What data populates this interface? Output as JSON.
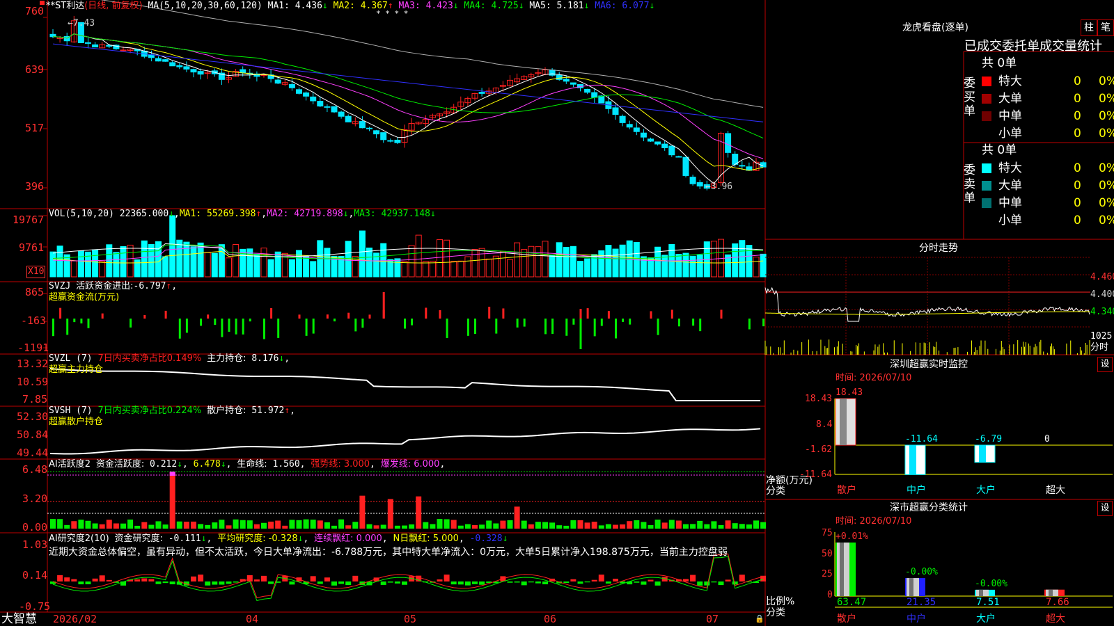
{
  "app_title": "大智慧",
  "colors": {
    "up": "#ff2020",
    "down": "#00e5ff",
    "vol_down": "#00ffff",
    "green": "#00ee00",
    "yellow": "#ffff00",
    "magenta": "#ff40ff",
    "blue": "#3030ff",
    "gray": "#b0b0b0",
    "border": "#c00000",
    "white": "#ffffff"
  },
  "main": {
    "stock": "**ST利达",
    "period": "(日线, 前复权)",
    "ma_legend": [
      {
        "name": "MA(5,10,20,30,60,120)",
        "value": "",
        "arrow": "",
        "color": "#ffffff"
      },
      {
        "name": "MA1:",
        "value": "4.436",
        "arrow": "↓",
        "color": "#ffffff"
      },
      {
        "name": "MA2:",
        "value": "4.367",
        "arrow": "↑",
        "color": "#ffff00"
      },
      {
        "name": "MA3:",
        "value": "4.423",
        "arrow": "↓",
        "color": "#ff40ff"
      },
      {
        "name": "MA4:",
        "value": "4.725",
        "arrow": "↓",
        "color": "#00ee00"
      },
      {
        "name": "MA5:",
        "value": "5.181",
        "arrow": "↓",
        "color": "#ffffff"
      },
      {
        "name": "MA6:",
        "value": "6.077",
        "arrow": "↓",
        "color": "#3030ff"
      }
    ],
    "y_ticks": [
      "760",
      "639",
      "517",
      "396"
    ],
    "high_label": "7.43",
    "low_label": "3.96",
    "stars": "* * *   *"
  },
  "volume": {
    "legend": "VOL(5,10,20)",
    "value": "22365.000",
    "ma1": "55269.398",
    "ma2": "42719.898",
    "ma3": "42937.148",
    "y_ticks": [
      "19767",
      "9761"
    ],
    "unit": "X10"
  },
  "svzj": {
    "legend": "SVZJ",
    "label": "活跃资金进出:",
    "value": "-6.797",
    "sub": "超赢资金流(万元)",
    "y_ticks": [
      "865",
      "-163",
      "-1191"
    ]
  },
  "svzl": {
    "legend": "SVZL (7)",
    "ratio_label": "7日内买卖净占比0.149%",
    "hold_label": "主力持仓:",
    "hold_value": "8.176",
    "sub": "超赢主力持仓",
    "y_ticks": [
      "13.32",
      "10.59",
      "7.85"
    ]
  },
  "svsh": {
    "legend": "SVSH (7)",
    "ratio_label": "7日内买卖净占比0.224%",
    "hold_label": "散户持仓:",
    "hold_value": "51.972",
    "sub": "超赢散户持仓",
    "y_ticks": [
      "52.30",
      "50.84",
      "49.44"
    ]
  },
  "ai_active": {
    "legend": "AI活跃度2",
    "fund_label": "资金活跃度:",
    "fund_value": "0.212",
    "v2": "6.478",
    "life_label": "生命线:",
    "life_value": "1.560",
    "strong": "强势线: 3.000",
    "burst": "爆发线: 6.000",
    "y_ticks": [
      "6.48",
      "3.20",
      "0.00"
    ]
  },
  "ai_research": {
    "legend": "AI研究度2(10)",
    "fund_label": "资金研究度:",
    "fund_value": "-0.111",
    "avg": "平均研究度: -0.328",
    "red": "连续飘红: 0.000",
    "n_red": "N日飘红: 5.000",
    "last": "-0.328",
    "comment": "近期大资金总体偏空，虽有异动，但不太活跃，今日大单净流出：-6.788万元，其中特大单净流入：0万元，大单5日累计净入198.875万元，当前主力控盘弱",
    "y_ticks": [
      "1.03",
      "0.14",
      "-0.75"
    ]
  },
  "x_axis": [
    "2026/02",
    "04",
    "05",
    "06",
    "07"
  ],
  "right": {
    "lhb_title": "龙虎看盘(逐单)",
    "btn_col": "柱",
    "btn_line": "笔",
    "tabs": "已成交委托单成交量统计",
    "buy_label": "委买单",
    "sell_label": "委卖单",
    "buy_total": "共 0单",
    "sell_total": "共 0单",
    "buy_rows": [
      {
        "name": "特大",
        "count": "0",
        "pct": "0%",
        "color": "#ff0000"
      },
      {
        "name": "大单",
        "count": "0",
        "pct": "0%",
        "color": "#a00000"
      },
      {
        "name": "中单",
        "count": "0",
        "pct": "0%",
        "color": "#700000"
      },
      {
        "name": "小单",
        "count": "0",
        "pct": "0%",
        "color": ""
      }
    ],
    "sell_rows": [
      {
        "name": "特大",
        "count": "0",
        "pct": "0%",
        "color": "#00ffff"
      },
      {
        "name": "大单",
        "count": "0",
        "pct": "0%",
        "color": "#009090"
      },
      {
        "name": "中单",
        "count": "0",
        "pct": "0%",
        "color": "#007070"
      },
      {
        "name": "小单",
        "count": "0",
        "pct": "0%",
        "color": ""
      }
    ],
    "intraday_title": "分时走势",
    "intraday_ticks": [
      "4.460",
      "4.400",
      "4.340"
    ],
    "intraday_vol": "1025",
    "intraday_unit": "分时",
    "sz_title": "深圳超赢实时监控",
    "settings": "设",
    "sz_time": "时间: 2026/07/10",
    "sz_ticks": [
      "18.43",
      "8.4",
      "-1.62",
      "-11.64"
    ],
    "sz_ylabel": "净额(万元)",
    "sz_xlabel": "分类",
    "sz_cats": [
      "散户",
      "中户",
      "大户",
      "超大"
    ],
    "sz_values": [
      18.43,
      -11.64,
      -6.79,
      0
    ],
    "sz_labels": [
      "18.43",
      "-11.64",
      "-6.79",
      "0"
    ],
    "cls_title": "深市超赢分类统计",
    "cls_time": "时间: 2026/07/10",
    "cls_ticks": [
      "75",
      "50",
      "25",
      "0"
    ],
    "cls_ylabel": "比例%",
    "cls_xlabel": "分类",
    "cls_cats": [
      "散户",
      "中户",
      "大户",
      "超大"
    ],
    "cls_values": [
      63.47,
      21.35,
      7.51,
      7.66
    ],
    "cls_top": [
      "+0.01%",
      "-0.00%",
      "-0.00%",
      ""
    ],
    "cls_bottom": [
      "63.47",
      "21.35",
      "7.51",
      "7.66"
    ]
  }
}
